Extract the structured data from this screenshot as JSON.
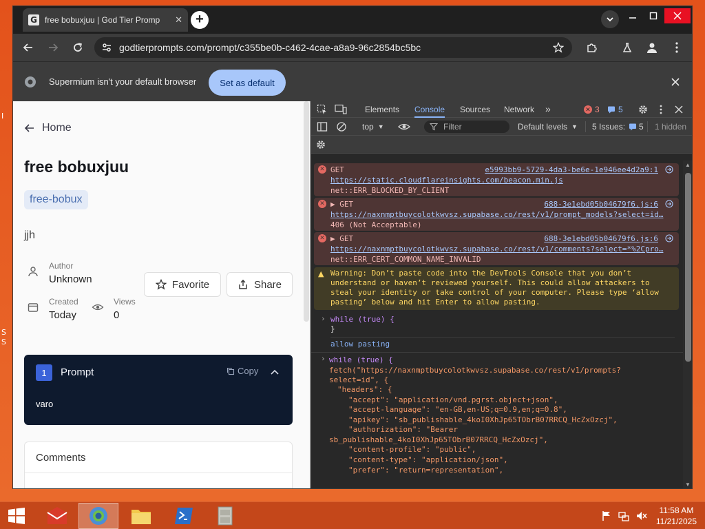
{
  "desktop": {
    "left_glyphs": [
      "I",
      "S",
      "S"
    ]
  },
  "browser": {
    "tab": {
      "favicon_letter": "G",
      "title": "free bobuxjuu | God Tier Promp"
    },
    "new_tab_symbol": "+",
    "url": "godtierprompts.com/prompt/c355be0b-c462-4cae-a8a9-96c2854bc5bc",
    "infobar": {
      "message": "Supermium isn't your default browser",
      "button": "Set as default"
    }
  },
  "page": {
    "home": "Home",
    "title": "free bobuxjuu",
    "tag": "free-bobux",
    "description": "jjh",
    "author_label": "Author",
    "author_value": "Unknown",
    "created_label": "Created",
    "created_value": "Today",
    "views_label": "Views",
    "views_value": "0",
    "favorite_label": "Favorite",
    "share_label": "Share",
    "prompt_number": "1",
    "prompt_heading": "Prompt",
    "copy_label": "Copy",
    "prompt_text": "varo",
    "comments_heading": "Comments"
  },
  "devtools": {
    "tabs": [
      "Elements",
      "Console",
      "Sources",
      "Network"
    ],
    "active_tab": "Console",
    "error_count": "3",
    "message_count": "5",
    "context": "top",
    "filter_placeholder": "Filter",
    "levels": "Default levels",
    "issues_label": "5 Issues:",
    "issues_count": "5",
    "hidden": "1 hidden",
    "messages": [
      {
        "method": "GET",
        "source": "e5993bb9-5729-4da3-be6e-1e946ee4d2a9:1",
        "url": "https://static.cloudflareinsights.com/beacon.min.js",
        "detail": "net::ERR_BLOCKED_BY_CLIENT"
      },
      {
        "method": "▶ GET",
        "source": "688-3e1ebd05b04679f6.js:6",
        "url": "https://naxnmptbuycolotkwvsz.supabase.co/rest/v1/prompt_models?select=id…",
        "detail": "406 (Not Acceptable)"
      },
      {
        "method": "▶ GET",
        "source": "688-3e1ebd05b04679f6.js:6",
        "url": "https://naxnmptbuycolotkwvsz.supabase.co/rest/v1/comments?select=*%2Cpro…",
        "detail": "net::ERR_CERT_COMMON_NAME_INVALID"
      }
    ],
    "warning_lines": [
      "Warning: Don’t paste code into the DevTools Console that you don’t",
      "understand or haven’t reviewed yourself. This could allow attackers to",
      "steal your identity or take control of your computer. Please type ‘allow",
      "pasting’ below and hit Enter to allow pasting."
    ],
    "while_true": "while (true) {",
    "close_brace": "}",
    "allow_pasting": "allow pasting",
    "code": {
      "while": "while (true) {",
      "fetch": "fetch(\"https://naxnmptbuycolotkwvsz.supabase.co/rest/v1/prompts?",
      "select": "select=id\", {",
      "headers": "\"headers\": {",
      "accept": "\"accept\": \"application/vnd.pgrst.object+json\",",
      "accept_language": "\"accept-language\": \"en-GB,en-US;q=0.9,en;q=0.8\",",
      "apikey": "\"apikey\": \"sb_publishable_4koI0XhJp65TObrB07RRCQ_HcZxOzcj\",",
      "authorization": "\"authorization\": \"Bearer",
      "authorization_cont": "sb_publishable_4koI0XhJp65TObrB07RRCQ_HcZxOzcj\",",
      "content_profile": "\"content-profile\": \"public\",",
      "content_type": "\"content-type\": \"application/json\",",
      "prefer": "\"prefer\": \"return=representation\","
    }
  },
  "taskbar": {
    "time": "11:58 AM",
    "date": "11/21/2025"
  },
  "colors": {
    "desktop": "#e3521b",
    "taskbar": "#c4471a",
    "accent": "#8ab4f8",
    "prompt_card": "#0e1a2e"
  }
}
